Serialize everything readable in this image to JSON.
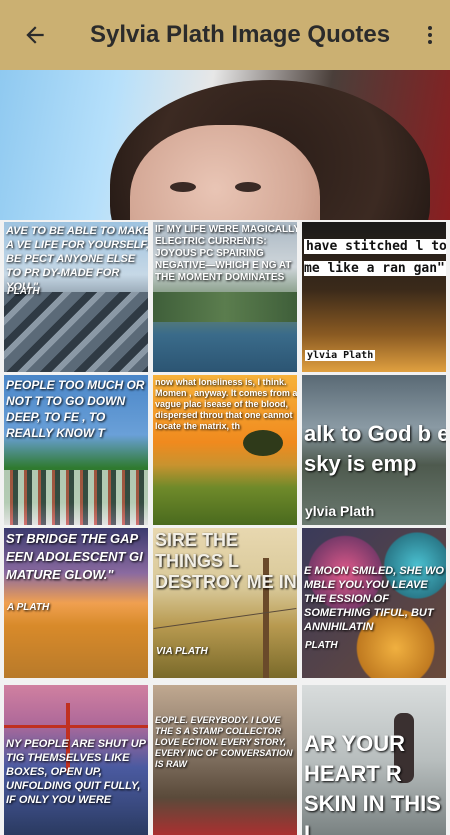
{
  "app_bar": {
    "title": "Sylvia Plath Image Quotes",
    "back_icon": "arrow-back-icon",
    "more_icon": "more-vert-icon",
    "background": "#cbb072"
  },
  "tiles": [
    {
      "quote": "AVE TO BE ABLE TO MAKE A VE LIFE FOR YOURSELF, BE PECT ANYONE ELSE TO PR DY-MADE FOR YOU.\"",
      "author": "PLATH"
    },
    {
      "quote": "IF MY LIFE WERE MAGICALLY ELECTRIC CURRENTS: JOYOUS PC SPAIRING NEGATIVE—WHICH E NG AT THE MOMENT DOMINATES",
      "author": ""
    },
    {
      "quote": "have stitched l to me like a ran gan\"",
      "author": "ylvia Plath"
    },
    {
      "quote": "PEOPLE TOO MUCH OR NOT T TO GO DOWN DEEP, TO FE , TO REALLY KNOW T",
      "author": ""
    },
    {
      "quote": "now what loneliness is, I think. Momen , anyway. It comes from a vague plac isease of the blood, dispersed throu that one cannot locate the matrix, th",
      "author": ""
    },
    {
      "quote": "alk to God b e sky is emp",
      "author": "ylvia Plath"
    },
    {
      "quote": "ST BRIDGE THE GAP EEN ADOLESCENT GI MATURE GLOW.\"",
      "author": "A PLATH"
    },
    {
      "quote": "SIRE THE THINGS L DESTROY ME IN",
      "author": "VIA PLATH"
    },
    {
      "quote": "E MOON SMILED, SHE WO MBLE YOU.YOU LEAVE THE ESSION.OF SOMETHING TIFUL, BUT ANNIHILATIN",
      "author": "PLATH"
    },
    {
      "quote": "NY PEOPLE ARE SHUT UP TIG THEMSELVES LIKE BOXES, OPEN UP, UNFOLDING QUIT FULLY, IF ONLY YOU WERE",
      "author": ""
    },
    {
      "quote": "EOPLE. EVERYBODY. I LOVE THE S A STAMP COLLECTOR LOVE ECTION. EVERY STORY, EVERY INC OF CONVERSATION IS RAW",
      "author": ""
    },
    {
      "quote": "AR YOUR HEART R SKIN IN THIS L",
      "author": ""
    }
  ]
}
